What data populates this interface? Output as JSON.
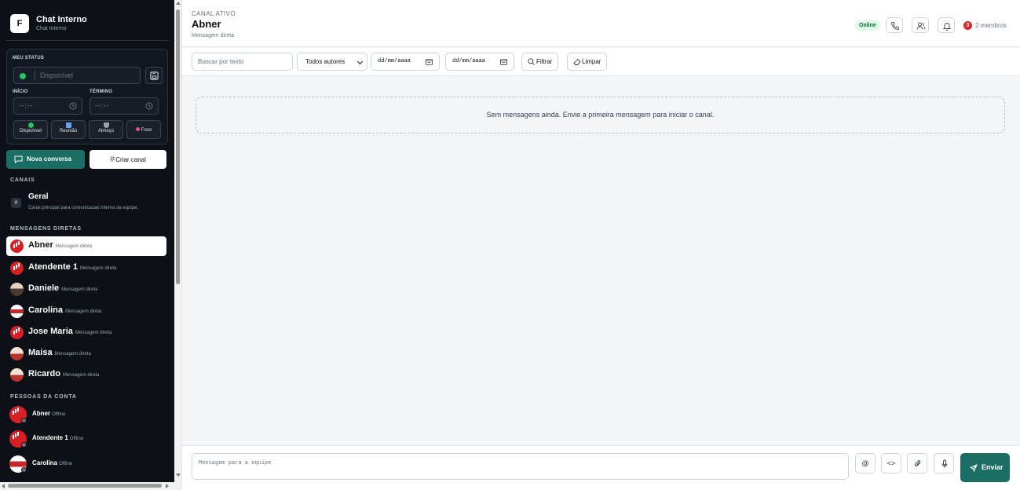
{
  "sidebar": {
    "brand": {
      "logo_letter": "F",
      "title": "Chat Interno",
      "subtitle": "Chat Interno"
    },
    "my_status": {
      "label": "MEU STATUS",
      "status_placeholder": "Disponível",
      "start_label": "INÍCIO",
      "end_label": "TÉRMINO",
      "start_value": "--:--",
      "end_value": "--:--",
      "quick": [
        {
          "label": "Disponível",
          "color": "#22c55e"
        },
        {
          "label": "Reunião",
          "color": "#60a5fa"
        },
        {
          "label": "Almoço",
          "color": "#a1a1aa"
        },
        {
          "label": "Foco",
          "color": "#ec4899"
        }
      ]
    },
    "new_conversation": "Nova conversa",
    "create_channel": "Criar canal",
    "channels_title": "CANAIS",
    "channels": [
      {
        "name": "Geral",
        "description": "Canal principal para comunicacao interna da equipe."
      }
    ],
    "dms_title": "MENSAGENS DIRETAS",
    "dms": [
      {
        "name": "Abner",
        "sub": "Mensagem direta",
        "active": true
      },
      {
        "name": "Atendente 1",
        "sub": "Mensagem direta"
      },
      {
        "name": "Daniele",
        "sub": "Mensagem direta"
      },
      {
        "name": "Carolina",
        "sub": "Mensagem direta"
      },
      {
        "name": "Jose Maria",
        "sub": "Mensagem direta"
      },
      {
        "name": "Maisa",
        "sub": "Mensagem direta"
      },
      {
        "name": "Ricardo",
        "sub": "Mensagem direta"
      }
    ],
    "people_title": "PESSOAS DA CONTA",
    "people": [
      {
        "name": "Abner",
        "status": "Offline"
      },
      {
        "name": "Atendente 1",
        "status": "Offline"
      },
      {
        "name": "Carolina",
        "status": "Offline"
      }
    ]
  },
  "header": {
    "kicker": "CANAL ATIVO",
    "title": "Abner",
    "subtitle": "Mensagem direta",
    "online": "Online",
    "notification_count": "3",
    "members": "2 membros"
  },
  "filters": {
    "search_placeholder": "Buscar por texto",
    "author_selected": "Todos autores",
    "date_from": "dd/mm/aaaa",
    "date_to": "dd/mm/aaaa",
    "filter_label": "Filtrar",
    "clear_label": "Limpar"
  },
  "empty_message": "Sem mensagens ainda. Envie a primeira mensagem para iniciar o canal.",
  "composer": {
    "placeholder": "Mensagem para a equipe",
    "send_label": "Enviar",
    "mention_symbol": "@",
    "code_symbol": "<>"
  },
  "colors": {
    "accent": "#1a6e66",
    "sidebar_bg": "#0d1117",
    "online_bg": "#dcfce7",
    "badge": "#dc2626"
  }
}
